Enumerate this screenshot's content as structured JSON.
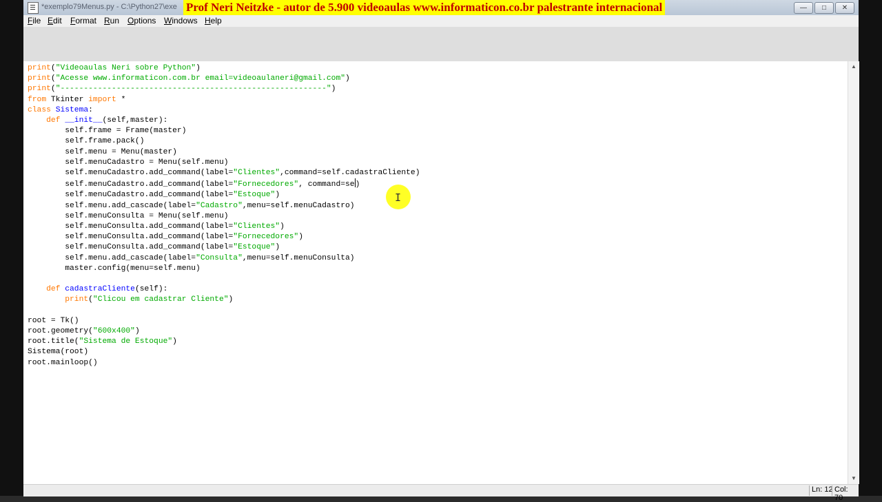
{
  "window": {
    "title": "*exemplo79Menus.py - C:\\Python27\\exe",
    "banner": "Prof Neri Neitzke - autor de 5.900 videoaulas www.informaticon.co.br palestrante internacional",
    "controls": {
      "minimize": "—",
      "maximize": "□",
      "close": "✕"
    }
  },
  "menubar": {
    "items": [
      {
        "underline": "F",
        "rest": "ile"
      },
      {
        "underline": "E",
        "rest": "dit"
      },
      {
        "underline": "F",
        "rest": "ormat",
        "pre": ""
      },
      {
        "underline": "R",
        "rest": "un"
      },
      {
        "underline": "O",
        "rest": "ptions"
      },
      {
        "underline": "W",
        "rest": "indows"
      },
      {
        "underline": "H",
        "rest": "elp"
      }
    ]
  },
  "editor": {
    "lines": [
      "print(\"Videoaulas Neri sobre Python\")",
      "print(\"Acesse www.informaticon.com.br email=videoaulaneri@gmail.com\")",
      "print(\"---------------------------------------------------------\")",
      "from Tkinter import *",
      "class Sistema:",
      "    def __init__(self,master):",
      "        self.frame = Frame(master)",
      "        self.frame.pack()",
      "        self.menu = Menu(master)",
      "        self.menuCadastro = Menu(self.menu)",
      "        self.menuCadastro.add_command(label=\"Clientes\",command=self.cadastraCliente)",
      "        self.menuCadastro.add_command(label=\"Fornecedores\", command=se)",
      "        self.menuCadastro.add_command(label=\"Estoque\")",
      "        self.menu.add_cascade(label=\"Cadastro\",menu=self.menuCadastro)",
      "        self.menuConsulta = Menu(self.menu)",
      "        self.menuConsulta.add_command(label=\"Clientes\")",
      "        self.menuConsulta.add_command(label=\"Fornecedores\")",
      "        self.menuConsulta.add_command(label=\"Estoque\")",
      "        self.menu.add_cascade(label=\"Consulta\",menu=self.menuConsulta)",
      "        master.config(menu=self.menu)",
      "",
      "    def cadastraCliente(self):",
      "        print(\"Clicou em cadastrar Cliente\")",
      "",
      "root = Tk()",
      "root.geometry(\"600x400\")",
      "root.title(\"Sistema de Estoque\")",
      "Sistema(root)",
      "root.mainloop()"
    ]
  },
  "statusbar": {
    "line": "Ln: 12",
    "col": "Col: 70"
  },
  "colors": {
    "keyword": "#ff7700",
    "builtin": "#900090",
    "string": "#00aa00",
    "definition": "#0000ff",
    "banner_bg": "#ffff00",
    "banner_text": "#c00000"
  }
}
